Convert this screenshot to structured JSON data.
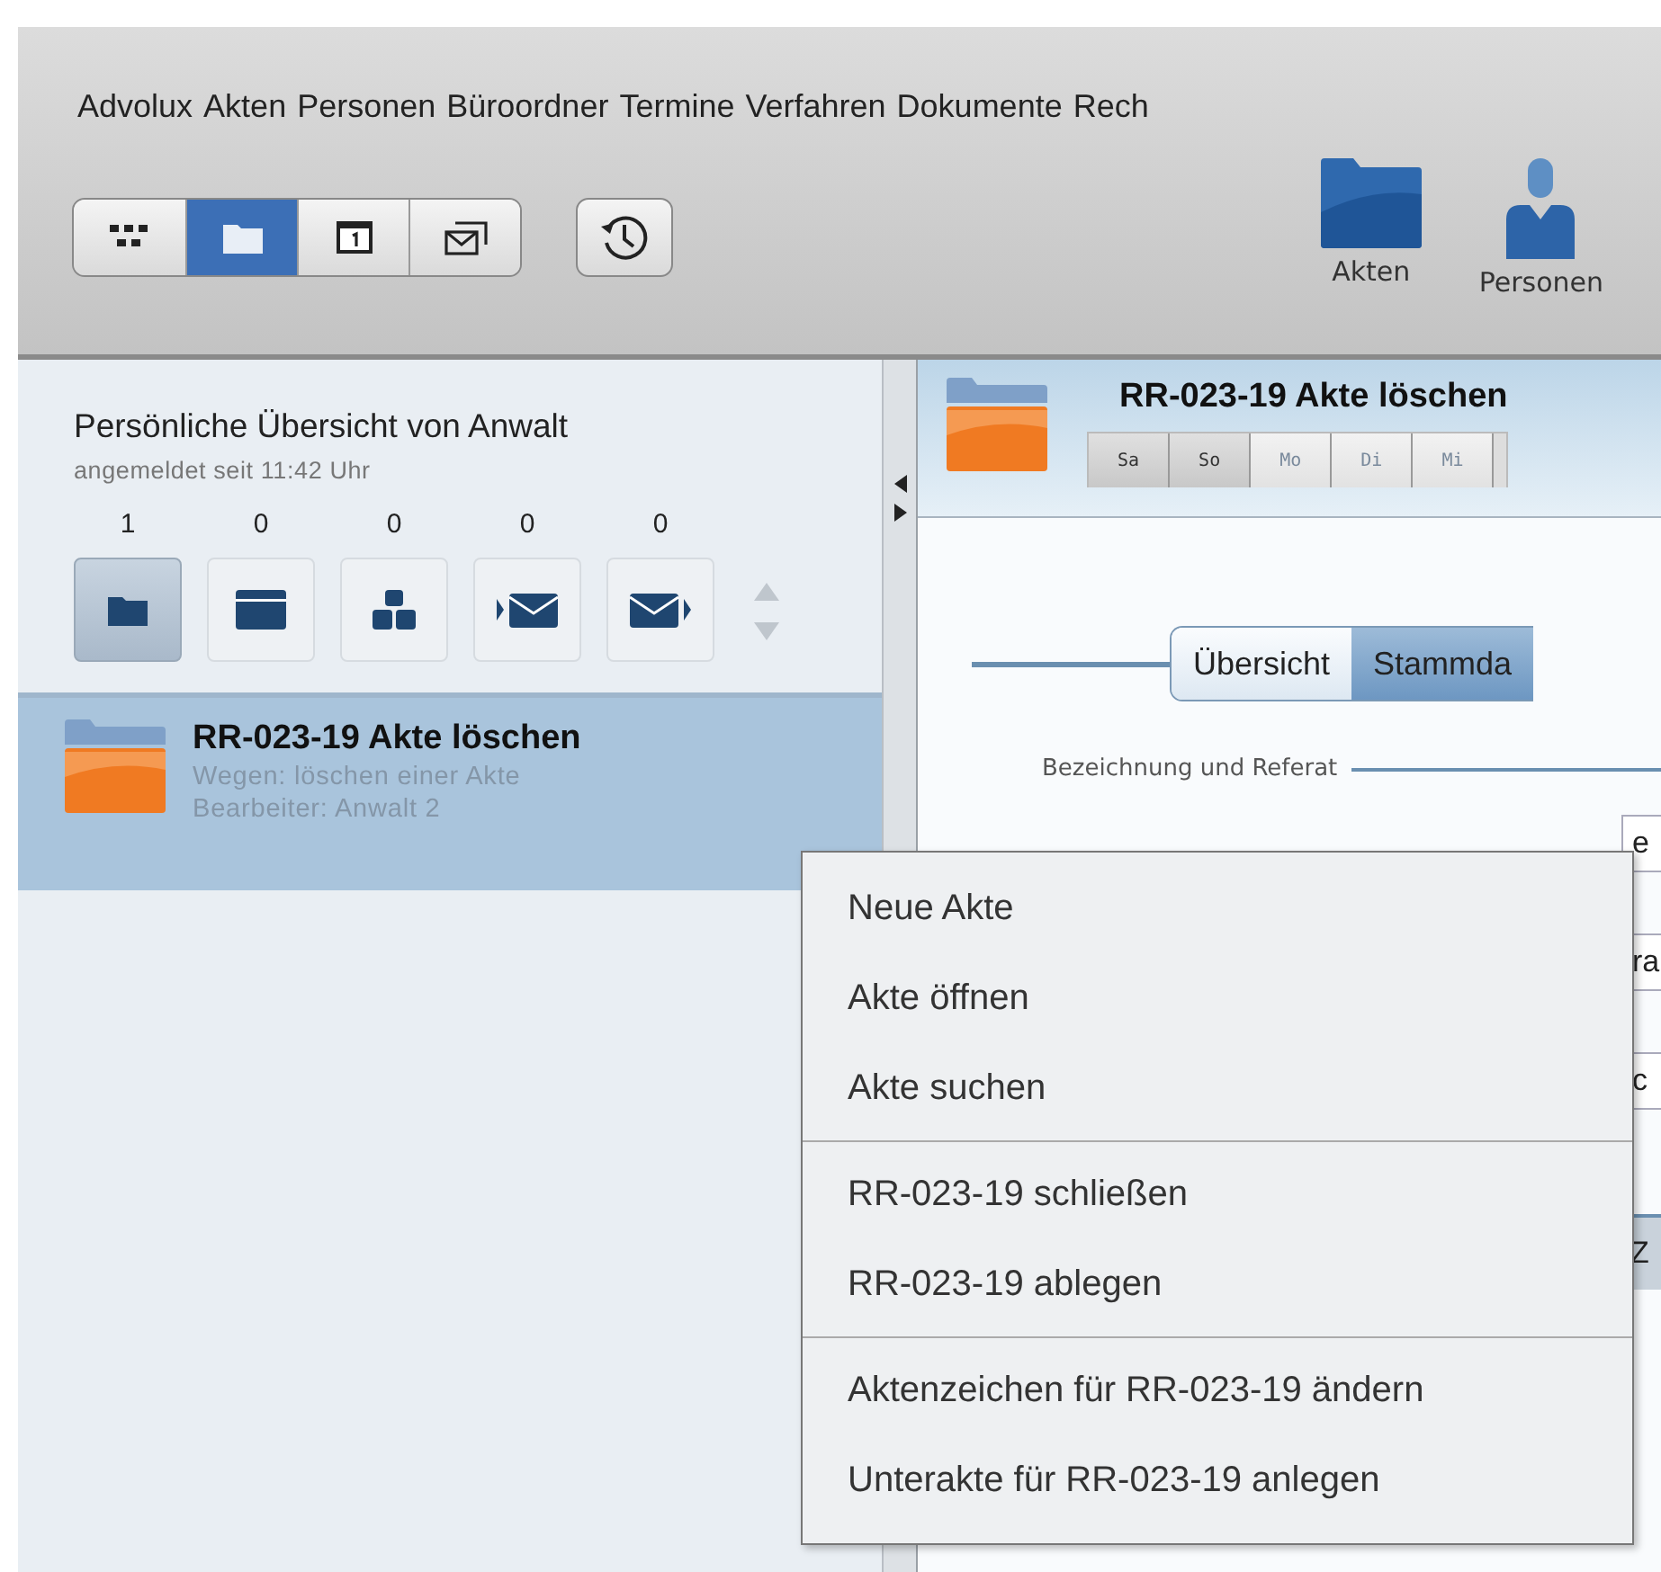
{
  "menu_bar": [
    {
      "label": "Advolux"
    },
    {
      "label": "Akten"
    },
    {
      "label": "Personen"
    },
    {
      "label": "Büroordner"
    },
    {
      "label": "Termine"
    },
    {
      "label": "Verfahren"
    },
    {
      "label": "Dokumente"
    },
    {
      "label": "Rech"
    }
  ],
  "view_switcher": [
    {
      "kind": "grid",
      "selected": false
    },
    {
      "kind": "folder",
      "selected": true
    },
    {
      "kind": "calendar",
      "selected": false
    },
    {
      "kind": "mail",
      "selected": false
    }
  ],
  "toolbar_buttons": [
    {
      "kind": "folder",
      "label": "Akten"
    },
    {
      "kind": "person",
      "label": "Personen"
    }
  ],
  "overview": {
    "title": "Persönliche Übersicht von Anwalt",
    "subtitle": "angemeldet seit 11:42 Uhr",
    "categories": [
      {
        "count": "1",
        "kind": "folder",
        "selected": true
      },
      {
        "count": "0",
        "kind": "window",
        "selected": false
      },
      {
        "count": "0",
        "kind": "group",
        "selected": false
      },
      {
        "count": "0",
        "kind": "mail-in",
        "selected": false
      },
      {
        "count": "0",
        "kind": "mail-out",
        "selected": false
      }
    ]
  },
  "files": [
    {
      "title": "RR-023-19 Akte löschen",
      "subject": "Wegen: löschen einer Akte",
      "editor": "Bearbeiter: Anwalt 2",
      "selected": true
    }
  ],
  "detail": {
    "title": "RR-023-19 Akte löschen",
    "day_tabs": [
      {
        "label": "Sa",
        "weekend": true
      },
      {
        "label": "So",
        "weekend": true
      },
      {
        "label": "Mo",
        "weekend": false
      },
      {
        "label": "Di",
        "weekend": false
      },
      {
        "label": "Mi",
        "weekend": false
      }
    ],
    "view_tabs": [
      {
        "label": "Übersicht",
        "selected": false
      },
      {
        "label": "Stammda",
        "selected": true
      }
    ],
    "section_label": "Bezeichnung und Referat",
    "fields": [
      {
        "value": "e"
      },
      {
        "value": "ra"
      },
      {
        "value": "c"
      }
    ],
    "table_header": "Z"
  },
  "context_menu": {
    "groups": [
      [
        "Neue Akte",
        "Akte öffnen",
        "Akte suchen"
      ],
      [
        "RR-023-19 schließen",
        "RR-023-19 ablegen"
      ],
      [
        "Aktenzeichen für RR-023-19 ändern",
        "Unterakte für RR-023-19 anlegen"
      ]
    ]
  }
}
